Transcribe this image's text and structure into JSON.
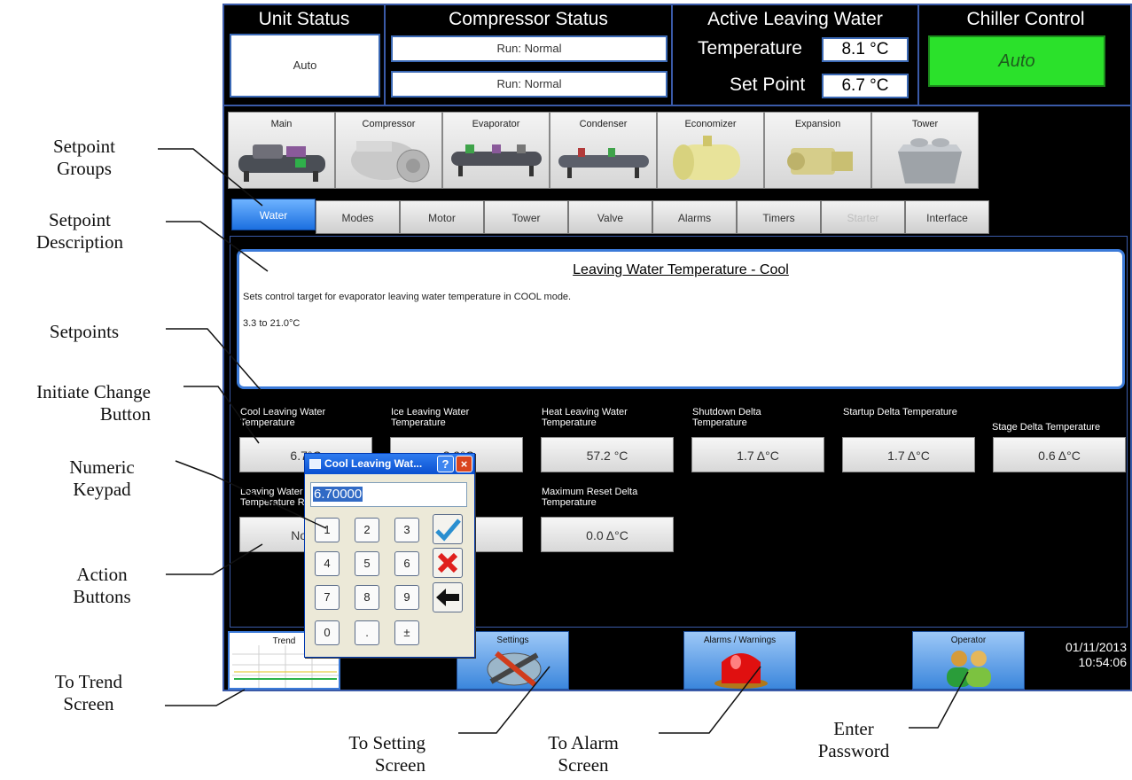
{
  "header": {
    "unit_status_title": "Unit Status",
    "unit_status_value": "Auto",
    "compressor_status_title": "Compressor Status",
    "compressor1_status": "Run: Normal",
    "compressor2_status": "Run: Normal",
    "lwt_title": "Active Leaving Water",
    "temperature_label": "Temperature",
    "temperature_value": "8.1 °C",
    "setpoint_label": "Set Point",
    "setpoint_value": "6.7 °C",
    "chiller_control_title": "Chiller Control",
    "chiller_control_value": "Auto"
  },
  "components": [
    "Main",
    "Compressor",
    "Evaporator",
    "Condenser",
    "Economizer",
    "Expansion",
    "Tower"
  ],
  "tabs": [
    "Water",
    "Modes",
    "Motor",
    "Tower",
    "Valve",
    "Alarms",
    "Timers",
    "Starter",
    "Interface"
  ],
  "active_tab": "Water",
  "description": {
    "title": "Leaving Water Temperature - Cool",
    "text": "Sets control target for evaporator leaving water temperature in COOL mode.",
    "range": "3.3 to 21.0°C"
  },
  "setpoints": [
    {
      "label": "Cool Leaving Water Temperature",
      "value": "6.7°C"
    },
    {
      "label": "Ice Leaving Water Temperature",
      "value": "-3.9°C"
    },
    {
      "label": "Heat Leaving Water Temperature",
      "value": "57.2 °C"
    },
    {
      "label": "Shutdown Delta Temperature",
      "value": "1.7 Δ°C"
    },
    {
      "label": "Startup Delta Temperature",
      "value": "1.7 Δ°C"
    },
    {
      "label": "Stage Delta Temperature",
      "value": "0.6 Δ°C"
    },
    {
      "label": "Leaving Water Temperature Reset",
      "value": "None"
    },
    {
      "label": "",
      "value": ""
    },
    {
      "label": "Maximum Reset Delta Temperature",
      "value": "0.0 Δ°C"
    }
  ],
  "keypad": {
    "title": "Cool Leaving Wat...",
    "help": "?",
    "close": "×",
    "display_value": "6.70000",
    "keys": [
      "1",
      "2",
      "3",
      "4",
      "5",
      "6",
      "7",
      "8",
      "9",
      "0",
      ".",
      "±"
    ]
  },
  "bottom": {
    "trend_label": "Trend",
    "settings_label": "Settings",
    "alarms_label": "Alarms / Warnings",
    "operator_label": "Operator",
    "date": "01/11/2013",
    "time": "10:54:06"
  },
  "callouts": {
    "setpoint_groups": [
      "Setpoint",
      "Groups"
    ],
    "setpoint_description": [
      "Setpoint",
      "Description"
    ],
    "setpoints": "Setpoints",
    "initiate_change": [
      "Initiate Change",
      "Button"
    ],
    "numeric_keypad": [
      "Numeric",
      "Keypad"
    ],
    "action_buttons": [
      "Action",
      "Buttons"
    ],
    "to_trend": [
      "To Trend",
      "Screen"
    ],
    "to_setting": [
      "To Setting",
      "Screen"
    ],
    "to_alarm": [
      "To Alarm",
      "Screen"
    ],
    "enter_password": [
      "Enter",
      "Password"
    ]
  },
  "colors": {
    "screen_bg": "#000000",
    "accent_blue": "#3b7ad8",
    "chiller_auto_green": "#2be12b",
    "tab_active": "#1b6fe0"
  }
}
